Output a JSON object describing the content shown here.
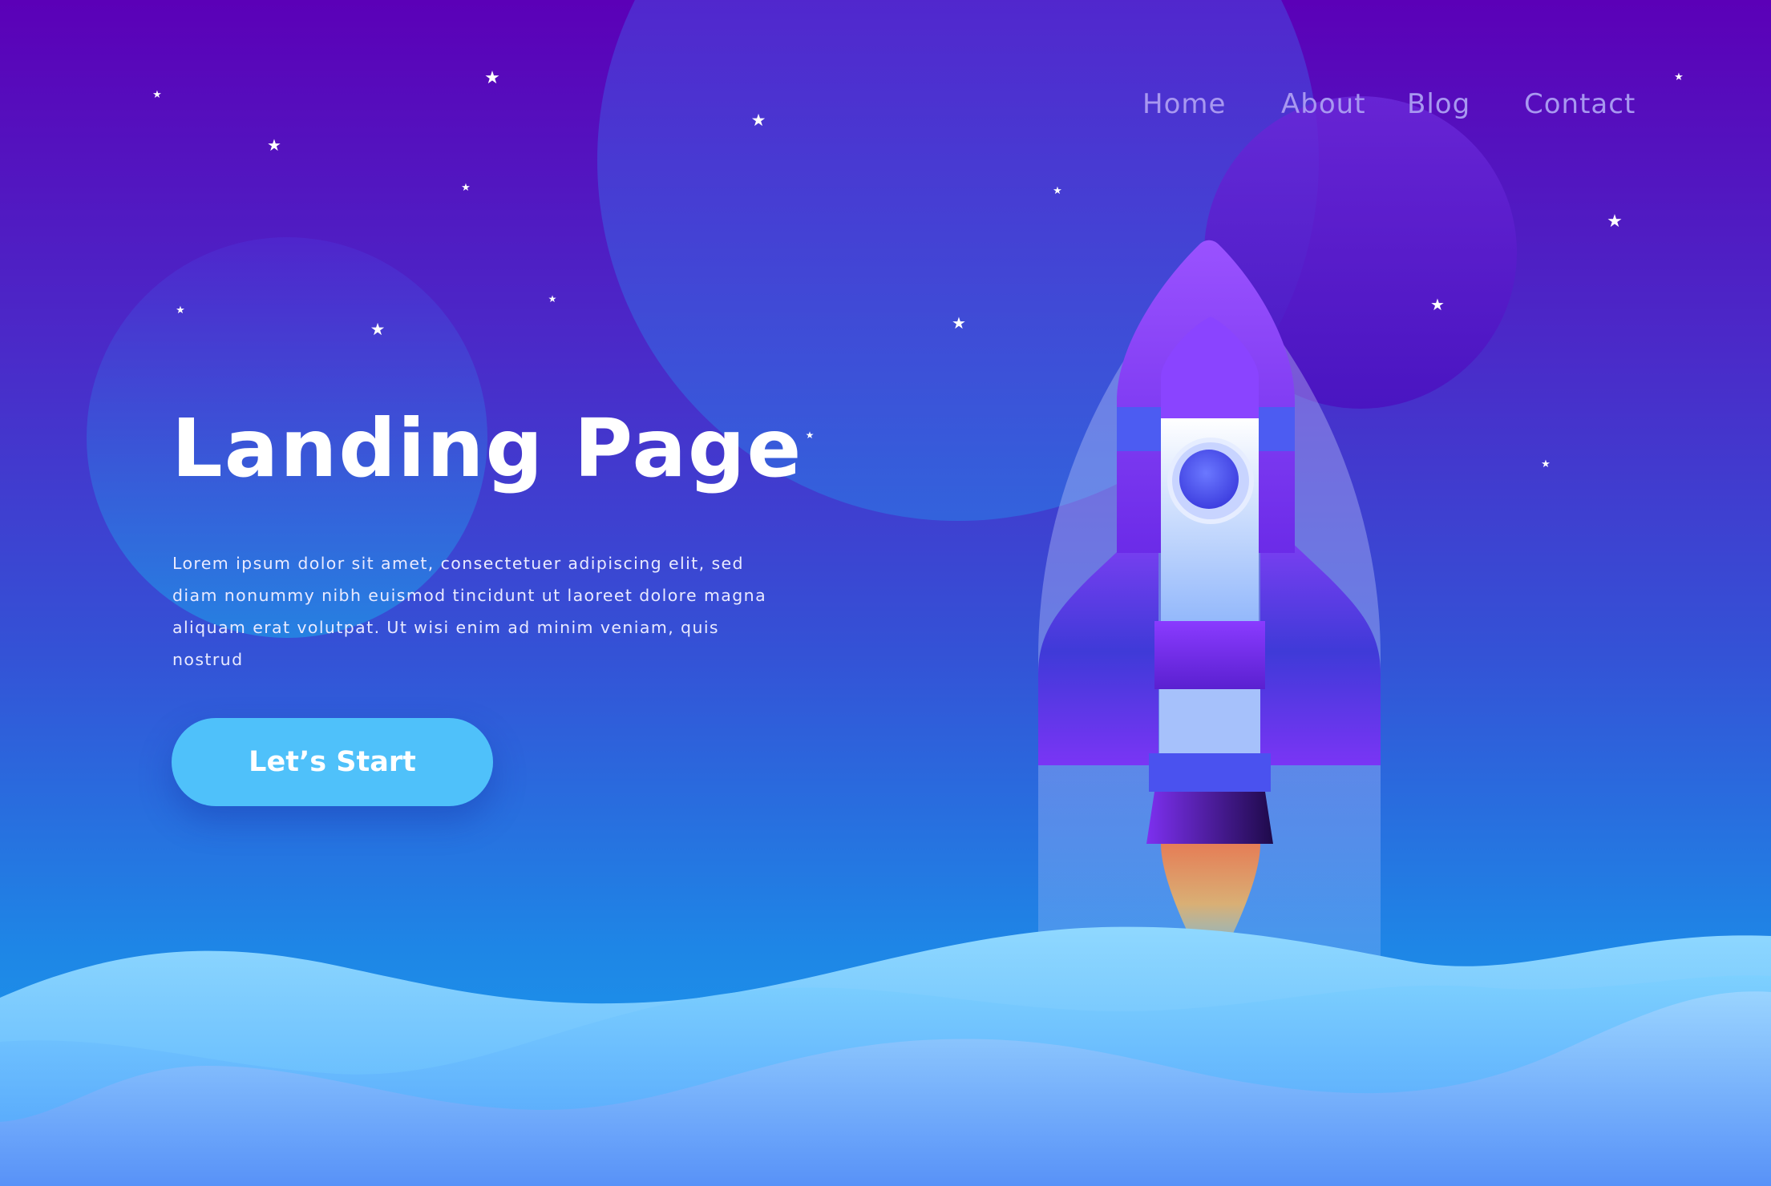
{
  "nav": {
    "items": [
      {
        "label": "Home"
      },
      {
        "label": "About"
      },
      {
        "label": "Blog"
      },
      {
        "label": "Contact"
      }
    ]
  },
  "hero": {
    "title": "Landing Page",
    "description": "Lorem ipsum dolor sit amet, consectetuer adipiscing elit, sed diam nonummy nibh euismod tincidunt ut laoreet dolore magna aliquam erat volutpat. Ut wisi enim ad minim veniam, quis nostrud",
    "cta_label": "Let’s Start"
  },
  "colors": {
    "background_top": "#5b00b7",
    "background_bottom": "#1aa2ee",
    "accent_button": "#4fc1fa",
    "nav_text": "#a898f0",
    "rocket_body": "#7b3df5"
  }
}
